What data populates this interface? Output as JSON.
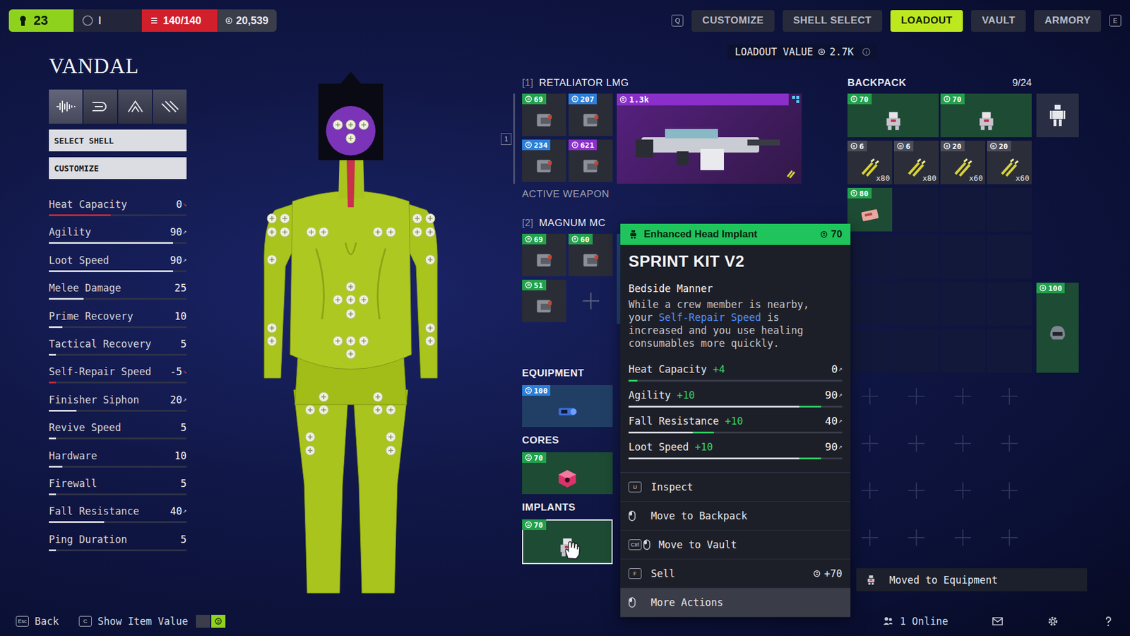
{
  "top_bar": {
    "level": "23",
    "rank": "I",
    "capacity": "140/140",
    "credits": "20,539",
    "prev_key": "Q",
    "next_key": "E",
    "tabs": [
      {
        "label": "CUSTOMIZE",
        "selected": false
      },
      {
        "label": "SHELL SELECT",
        "selected": false
      },
      {
        "label": "LOADOUT",
        "selected": true
      },
      {
        "label": "VAULT",
        "selected": false
      },
      {
        "label": "ARMORY",
        "selected": false
      }
    ]
  },
  "loadout_value": {
    "label": "LOADOUT VALUE",
    "value": "2.7K"
  },
  "shell": {
    "name": "VANDAL",
    "buttons": [
      "SELECT SHELL",
      "CUSTOMIZE"
    ],
    "stats": [
      {
        "label": "Heat Capacity",
        "value": "0",
        "level": 0.45,
        "arrow": "↘",
        "negative": true
      },
      {
        "label": "Agility",
        "value": "90",
        "level": 0.9,
        "arrow": "↗",
        "negative": false
      },
      {
        "label": "Loot Speed",
        "value": "90",
        "level": 0.9,
        "arrow": "↗",
        "negative": false
      },
      {
        "label": "Melee Damage",
        "value": "25",
        "level": 0.25,
        "negative": false
      },
      {
        "label": "Prime Recovery",
        "value": "10",
        "level": 0.1,
        "negative": false
      },
      {
        "label": "Tactical Recovery",
        "value": "5",
        "level": 0.05,
        "negative": false
      },
      {
        "label": "Self-Repair Speed",
        "value": "-5",
        "level": 0.05,
        "arrow": "↘",
        "negative": true
      },
      {
        "label": "Finisher Siphon",
        "value": "20",
        "level": 0.2,
        "arrow": "↗",
        "negative": false
      },
      {
        "label": "Revive Speed",
        "value": "5",
        "level": 0.05,
        "negative": false
      },
      {
        "label": "Hardware",
        "value": "10",
        "level": 0.1,
        "negative": false
      },
      {
        "label": "Firewall",
        "value": "5",
        "level": 0.05,
        "negative": false
      },
      {
        "label": "Fall Resistance",
        "value": "40",
        "level": 0.4,
        "arrow": "↗",
        "negative": false
      },
      {
        "label": "Ping Duration",
        "value": "5",
        "level": 0.05,
        "negative": false
      }
    ]
  },
  "weapons": [
    {
      "slot": "[1]",
      "selector": "1",
      "name": "RETALIATOR LMG",
      "price": "1.3k",
      "color": "#8a2fc9",
      "caption": "ACTIVE WEAPON",
      "mods": [
        {
          "kind": "item",
          "price": "69",
          "color": "#22a04b"
        },
        {
          "kind": "item",
          "price": "207",
          "color": "#2b7fd8"
        },
        {
          "kind": "item",
          "price": "234",
          "color": "#2b7fd8"
        },
        {
          "kind": "item",
          "price": "621",
          "color": "#8a2fc9"
        }
      ]
    },
    {
      "slot": "[2]",
      "name": "MAGNUM MC",
      "color": "#2b7fd8",
      "mods": [
        {
          "kind": "item",
          "price": "69",
          "color": "#22a04b"
        },
        {
          "kind": "item",
          "price": "60",
          "color": "#22a04b"
        },
        {
          "kind": "item",
          "price": "51",
          "color": "#22a04b"
        },
        {
          "kind": "empty"
        }
      ]
    }
  ],
  "sections": [
    {
      "label": "EQUIPMENT",
      "kind": "equipment",
      "items": [
        {
          "price": "100",
          "color": "#2b7fd8",
          "hovered": false
        }
      ]
    },
    {
      "label": "CORES",
      "kind": "core",
      "items": [
        {
          "price": "70",
          "color": "#22a04b",
          "hovered": false
        }
      ]
    },
    {
      "label": "IMPLANTS",
      "kind": "implant",
      "items": [
        {
          "price": "70",
          "color": "#22a04b",
          "hovered": true
        }
      ]
    }
  ],
  "backpack": {
    "title": "BACKPACK",
    "count": "9/24",
    "slots": 24,
    "items": [
      {
        "kind": "implant",
        "price": "70",
        "color": "#22a04b"
      },
      {
        "kind": "implant",
        "price": "70",
        "color": "#22a04b"
      },
      {
        "kind": "ammo",
        "price": "6",
        "quantity": "x80",
        "color": "#4a4d57"
      },
      {
        "kind": "ammo",
        "price": "6",
        "quantity": "x80",
        "color": "#4a4d57"
      },
      {
        "kind": "ammo",
        "price": "20",
        "quantity": "x60",
        "color": "#4a4d57"
      },
      {
        "kind": "ammo",
        "price": "20",
        "quantity": "x60",
        "color": "#4a4d57"
      },
      {
        "kind": "consumable",
        "price": "80",
        "color": "#22a04b"
      }
    ],
    "side_item": {
      "kind": "shield",
      "price": "100",
      "color": "#22a04b"
    }
  },
  "tooltip": {
    "category": "Enhanced Head Implant",
    "price": "70",
    "name": "SPRINT KIT V2",
    "perk": "Bedside Manner",
    "description": [
      {
        "text": "While a crew member is nearby, your ",
        "highlight": false
      },
      {
        "text": "Self-Repair Speed",
        "highlight": true
      },
      {
        "text": " is increased and you use healing consumables more quickly.",
        "highlight": false
      }
    ],
    "stats": [
      {
        "label": "Heat Capacity",
        "delta": "+4",
        "value": "0",
        "arrow": "↗",
        "level": 0.04,
        "gain": 0.04
      },
      {
        "label": "Agility",
        "delta": "+10",
        "value": "90",
        "arrow": "↗",
        "level": 0.9,
        "gain": 0.1
      },
      {
        "label": "Fall Resistance",
        "delta": "+10",
        "value": "40",
        "arrow": "↗",
        "level": 0.4,
        "gain": 0.1
      },
      {
        "label": "Loot Speed",
        "delta": "+10",
        "value": "90",
        "arrow": "↗",
        "level": 0.9,
        "gain": 0.1
      }
    ],
    "actions": [
      {
        "kind": "key",
        "key": "U",
        "label": "Inspect",
        "selected": false
      },
      {
        "kind": "mouse",
        "label": "Move to Backpack",
        "selected": false
      },
      {
        "kind": "key+mouse",
        "key": "Ctrl",
        "label": "Move to Vault",
        "selected": false
      },
      {
        "kind": "key",
        "key": "F",
        "label": "Sell",
        "price": "+70",
        "selected": false
      },
      {
        "kind": "mouse",
        "label": "More Actions",
        "selected": true
      }
    ]
  },
  "toast": {
    "text": "Moved to Equipment"
  },
  "bottom_bar": {
    "actions": [
      {
        "key": "Esc",
        "label": "Back",
        "toggle": false
      },
      {
        "key": "C",
        "label": "Show Item Value",
        "toggle": true,
        "on": true
      }
    ],
    "online": "1 Online"
  }
}
